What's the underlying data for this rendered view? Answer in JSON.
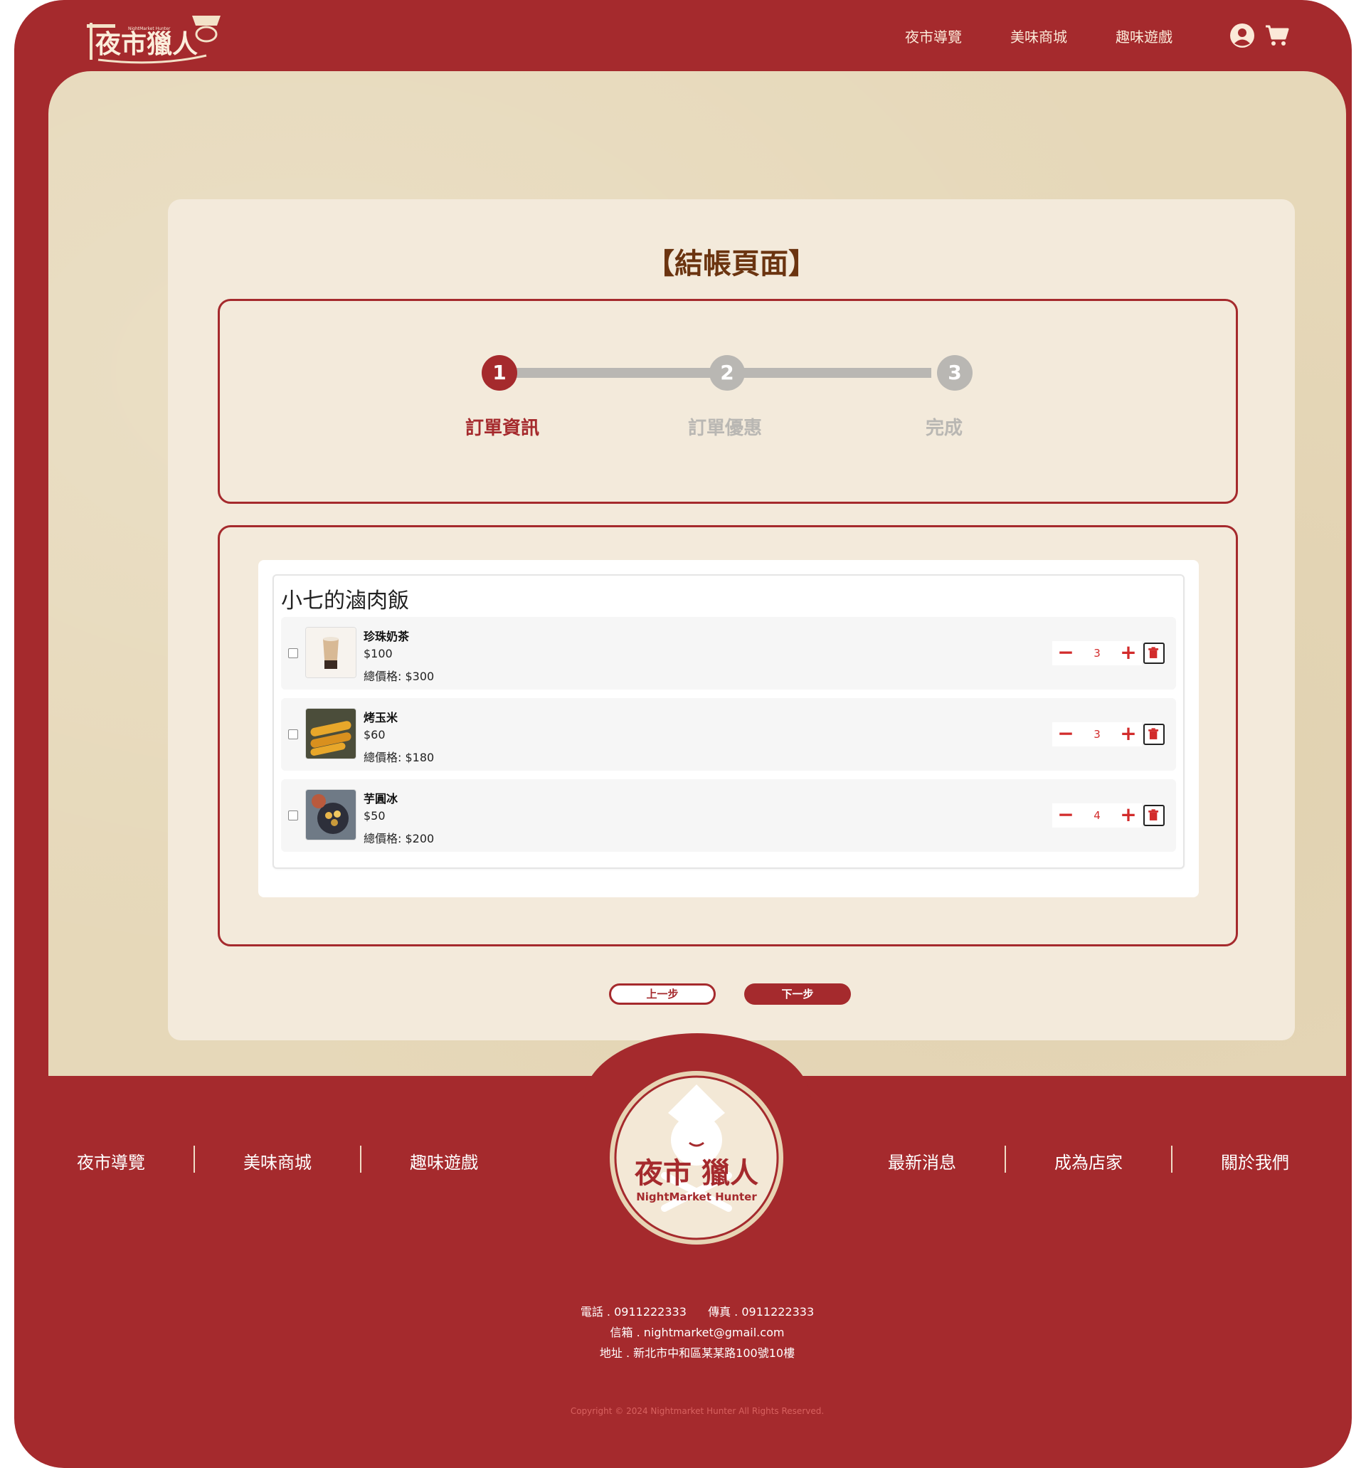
{
  "brand": {
    "logo_text": "夜市獵人",
    "logo_sub": "NightMarket Hunter"
  },
  "header": {
    "nav": [
      "夜市導覽",
      "美味商城",
      "趣味遊戲"
    ],
    "user_icon": "user-circle-icon",
    "cart_icon": "cart-icon"
  },
  "page": {
    "title": "【結帳頁面】"
  },
  "steps": [
    {
      "number": "1",
      "label": "訂單資訊",
      "active": true
    },
    {
      "number": "2",
      "label": "訂單優惠",
      "active": false
    },
    {
      "number": "3",
      "label": "完成",
      "active": false
    }
  ],
  "cart": {
    "shop_name": "小七的滷肉飯",
    "items": [
      {
        "name": "珍珠奶茶",
        "price": "$100",
        "total": "總價格: $300",
        "qty": "3",
        "thumb_icon": "bubble-tea-image"
      },
      {
        "name": "烤玉米",
        "price": "$60",
        "total": "總價格: $180",
        "qty": "3",
        "thumb_icon": "grilled-corn-image"
      },
      {
        "name": "芋圓冰",
        "price": "$50",
        "total": "總價格: $200",
        "qty": "4",
        "thumb_icon": "taro-ball-ice-image"
      }
    ],
    "minus_symbol": "−",
    "plus_symbol": "+"
  },
  "actions": {
    "prev": "上一步",
    "next": "下一步"
  },
  "footer": {
    "nav_left": [
      "夜市導覽",
      "美味商城",
      "趣味遊戲"
    ],
    "nav_right": [
      "最新消息",
      "成為店家",
      "關於我們"
    ],
    "emblem_text": "夜市 獵人",
    "emblem_sub": "NightMarket Hunter",
    "phone_line": "電話 . 0911222333",
    "fax_line": "傳真 . 0911222333",
    "email_line": "信箱 . nightmarket@gmail.com",
    "address_line": "地址 . 新北市中和區某某路100號10樓",
    "copyright": "Copyright © 2024 Nightmarket Hunter All Rights Reserved."
  },
  "colors": {
    "brand_red": "#a52a2d",
    "paper": "#e6d8b9",
    "card": "#f3eadb",
    "title_brown": "#6b3410",
    "inactive_gray": "#b9b7b3",
    "qty_red": "#d22b2b"
  }
}
